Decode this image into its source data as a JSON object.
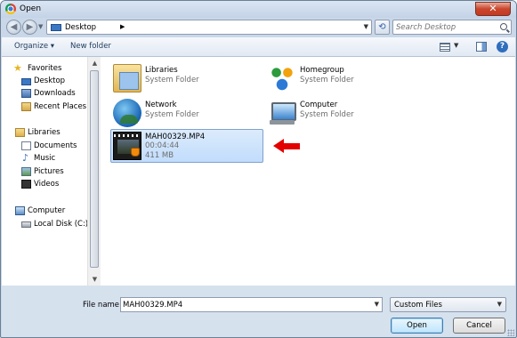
{
  "window": {
    "title": "Open",
    "title_icon": "chrome-icon"
  },
  "address": {
    "location": "Desktop",
    "search_placeholder": "Search Desktop"
  },
  "toolbar": {
    "organize_label": "Organize ▾",
    "new_folder_label": "New folder"
  },
  "sidebar": {
    "favorites": {
      "label": "Favorites",
      "items": [
        {
          "label": "Desktop"
        },
        {
          "label": "Downloads"
        },
        {
          "label": "Recent Places"
        }
      ]
    },
    "libraries": {
      "label": "Libraries",
      "items": [
        {
          "label": "Documents"
        },
        {
          "label": "Music"
        },
        {
          "label": "Pictures"
        },
        {
          "label": "Videos"
        }
      ]
    },
    "computer": {
      "label": "Computer",
      "items": [
        {
          "label": "Local Disk (C:)"
        }
      ]
    }
  },
  "files": [
    {
      "name": "Libraries",
      "line2": "System Folder",
      "icon": "libraries-icon"
    },
    {
      "name": "Homegroup",
      "line2": "System Folder",
      "icon": "homegroup-icon"
    },
    {
      "name": "Network",
      "line2": "System Folder",
      "icon": "network-icon"
    },
    {
      "name": "Computer",
      "line2": "System Folder",
      "icon": "computer-icon"
    },
    {
      "name": "MAH00329.MP4",
      "line2": "00:04:44",
      "line3": "411 MB",
      "icon": "video-file-icon",
      "selected": true
    }
  ],
  "annotation": {
    "arrow_color": "#e30000"
  },
  "footer": {
    "file_name_label": "File name:",
    "file_name_value": "MAH00329.MP4",
    "file_type_value": "Custom Files",
    "open_label": "Open",
    "cancel_label": "Cancel"
  },
  "colors": {
    "selection": "#c1dcfc",
    "chrome": "#c9d7e8",
    "close_button": "#c9462c"
  }
}
